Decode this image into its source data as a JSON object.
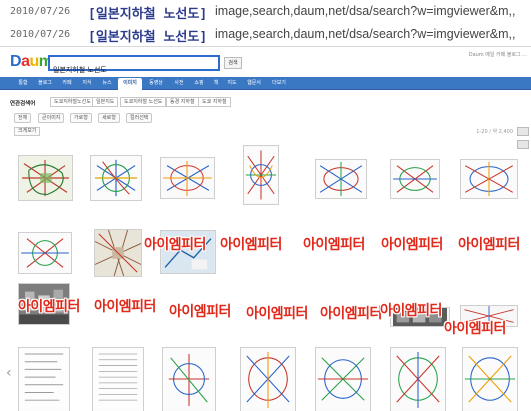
{
  "history": [
    {
      "date": "2010/07/26",
      "title": "[일본지하철 노선도]",
      "url": "image,search,daum,net/dsa/search?w=imgviewer&m,,"
    },
    {
      "date": "2010/07/26",
      "title": "[일본지하철 노선도]",
      "url": "image,search,daum,net/dsa/search?w=imgviewer&m,,"
    }
  ],
  "site": {
    "logo": "Daum",
    "search_value": "일본지하철 노선도",
    "search_button": "검색",
    "top_links": "Daum  메일  카페  블로그  ...",
    "tabs": [
      "통합",
      "블로그",
      "카페",
      "지식",
      "뉴스",
      "이미지",
      "동영상",
      "사전",
      "쇼핑",
      "책",
      "지도",
      "웹문서",
      "더보기"
    ],
    "active_tab": "이미지"
  },
  "filters": {
    "mode_label": "연관검색어",
    "related": [
      "도쿄지하철노선도",
      "일본지도",
      "도쿄지하철 노선도",
      "동경 지하철",
      "도쿄 지하철"
    ],
    "options": [
      "전체",
      "큰이미지",
      "가로형",
      "세로형",
      "컬러선택"
    ],
    "view_more": "크게보기",
    "pager": "1-20 / 약 2,400"
  },
  "watermark_text": "아이엠피터",
  "icons": {
    "left": "chevron-left-icon"
  }
}
